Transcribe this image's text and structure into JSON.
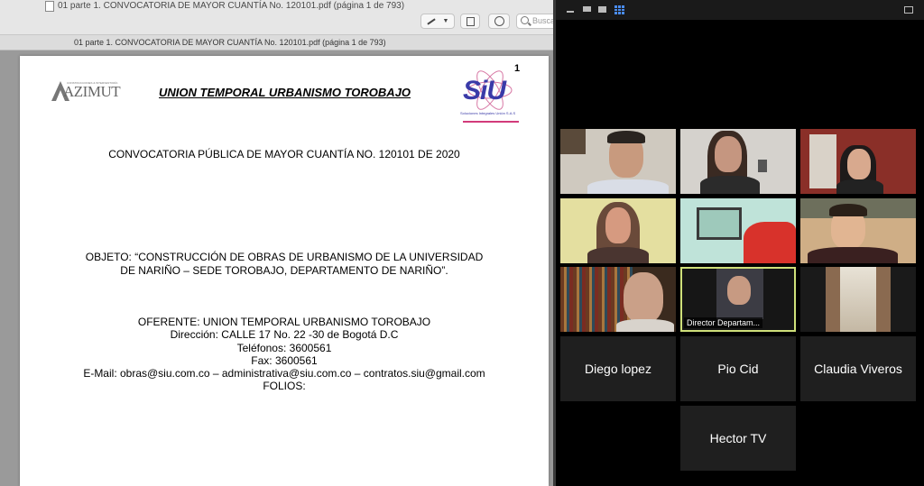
{
  "viewer": {
    "window_title": "01 parte 1. CONVOCATORIA DE MAYOR CUANTÍA No. 120101.pdf (página 1 de 793)",
    "subtitle": "01 parte 1. CONVOCATORIA DE MAYOR CUANTÍA No. 120101.pdf (página 1 de 793)",
    "search_placeholder": "Buscar"
  },
  "document": {
    "logo_left": "AZIMUT",
    "logo_left_tagline": "CONSTRUCCIONES & INTERVENTORÍA",
    "company": "UNION TEMPORAL URBANISMO TOROBAJO",
    "logo_right": "SiU",
    "logo_right_tagline": "Soluciones Integrales Unión S.A.S",
    "page_number": "1",
    "convocatoria": "CONVOCATORIA PÚBLICA DE MAYOR CUANTÍA NO. 120101 DE 2020",
    "objeto_line1": "OBJETO: “CONSTRUCCIÓN DE OBRAS DE URBANISMO DE LA UNIVERSIDAD",
    "objeto_line2": "DE NARIÑO – SEDE TOROBAJO, DEPARTAMENTO DE NARIÑO”.",
    "oferente": "OFERENTE: UNION TEMPORAL URBANISMO TOROBAJO",
    "direccion": "Dirección: CALLE 17 No. 22 -30 de Bogotá D.C",
    "telefonos": "Teléfonos: 3600561",
    "fax": "Fax: 3600561",
    "email": "E-Mail: obras@siu.com.co – administrativa@siu.com.co – contratos.siu@gmail.com",
    "folios": "FOLIOS:"
  },
  "call": {
    "active_speaker_caption": "Director Departam...",
    "name_tiles": [
      "Diego lopez",
      "Pio Cid",
      "Claudia Viveros",
      "Hector TV"
    ]
  }
}
